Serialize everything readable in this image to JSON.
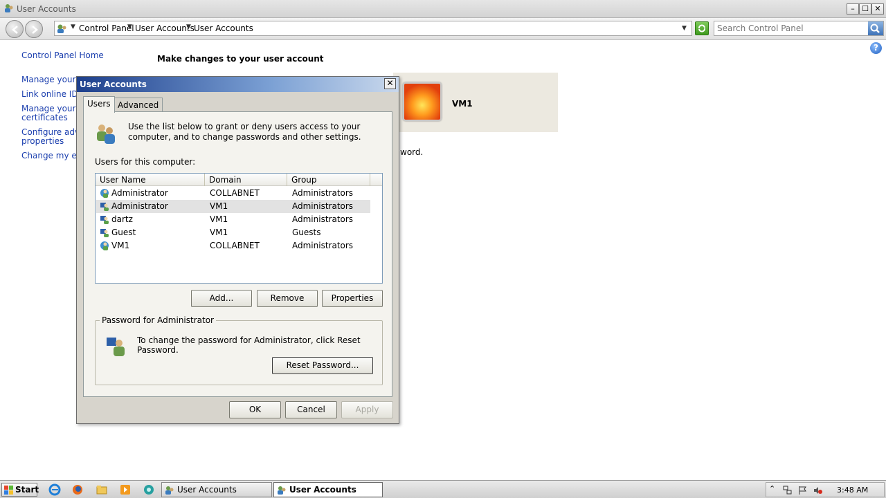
{
  "window": {
    "title": "User Accounts"
  },
  "navbar": {
    "breadcrumbs": [
      "Control Panel",
      "User Accounts",
      "User Accounts"
    ],
    "search_placeholder": "Search Control Panel"
  },
  "left_nav": {
    "home": "Control Panel Home",
    "links": [
      "Manage your cre",
      "Link online IDs",
      "Manage your file",
      "certificates",
      "Configure advan",
      "properties",
      "Change my envi"
    ]
  },
  "main": {
    "heading": "Make changes to your user account",
    "user_name": "VM1",
    "partial_text": "word."
  },
  "dialog": {
    "title": "User Accounts",
    "tabs": [
      "Users",
      "Advanced"
    ],
    "intro": "Use the list below to grant or deny users access to your computer, and to change passwords and other settings.",
    "users_label": "Users for this computer:",
    "columns": [
      "User Name",
      "Domain",
      "Group"
    ],
    "users": [
      {
        "name": "Administrator",
        "domain": "COLLABNET",
        "group": "Administrators"
      },
      {
        "name": "Administrator",
        "domain": "VM1",
        "group": "Administrators"
      },
      {
        "name": "dartz",
        "domain": "VM1",
        "group": "Administrators"
      },
      {
        "name": "Guest",
        "domain": "VM1",
        "group": "Guests"
      },
      {
        "name": "VM1",
        "domain": "COLLABNET",
        "group": "Administrators"
      }
    ],
    "selected_row": 1,
    "buttons": {
      "add": "Add...",
      "remove": "Remove",
      "properties": "Properties"
    },
    "password_group": {
      "title": "Password for Administrator",
      "text": "To change the password for Administrator, click Reset Password.",
      "reset": "Reset Password..."
    },
    "footer": {
      "ok": "OK",
      "cancel": "Cancel",
      "apply": "Apply"
    }
  },
  "taskbar": {
    "start": "Start",
    "tasks": [
      "User Accounts",
      "User Accounts"
    ],
    "active_task": 1,
    "clock": "3:48 AM"
  }
}
